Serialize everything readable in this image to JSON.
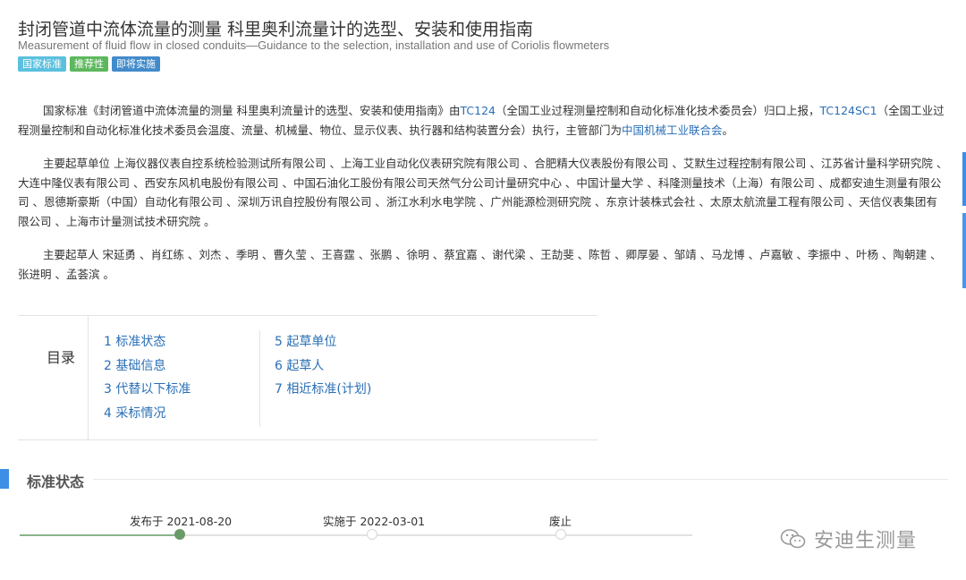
{
  "header": {
    "title": "封闭管道中流体流量的测量 科里奥利流量计的选型、安装和使用指南",
    "subtitle": "Measurement of fluid flow in closed conduits—Guidance to the selection, installation and use of Coriolis flowmeters",
    "badges": [
      {
        "label": "国家标准",
        "color": "#5bc0de"
      },
      {
        "label": "推荐性",
        "color": "#5cb85c"
      },
      {
        "label": "即将实施",
        "color": "#428bca"
      }
    ]
  },
  "intro": {
    "t1": "国家标准《封闭管道中流体流量的测量 科里奥利流量计的选型、安装和使用指南》由",
    "link1": "TC124",
    "t2": "（全国工业过程测量控制和自动化标准化技术委员会）归口上报，",
    "link2": "TC124SC1",
    "t3": "（全国工业过程测量控制和自动化标准化技术委员会温度、流量、机械量、物位、显示仪表、执行器和结构装置分会）执行，主管部门为",
    "link3": "中国机械工业联合会",
    "t4": "。"
  },
  "drafting_units": "主要起草单位 上海仪器仪表自控系统检验测试所有限公司 、上海工业自动化仪表研究院有限公司 、合肥精大仪表股份有限公司 、艾默生过程控制有限公司 、江苏省计量科学研究院 、大连中隆仪表有限公司 、西安东风机电股份有限公司 、中国石油化工股份有限公司天然气分公司计量研究中心 、中国计量大学 、科隆测量技术（上海）有限公司 、成都安迪生测量有限公司 、恩德斯豪斯（中国）自动化有限公司 、深圳万讯自控股份有限公司 、浙江水利水电学院 、广州能源检测研究院 、东京计装株式会社 、太原太航流量工程有限公司 、天信仪表集团有限公司 、上海市计量测试技术研究院 。",
  "drafters": "主要起草人 宋延勇 、肖红练 、刘杰 、季明 、曹久莹 、王喜霆 、张鹏 、徐明 、蔡宜嘉 、谢代梁 、王劼斐 、陈哲 、卿厚晏 、邹靖 、马龙博 、卢嘉敏 、李振中 、叶杨 、陶朝建 、张进明 、孟荟滨 。",
  "toc": {
    "heading": "目录",
    "col1": [
      "1  标准状态",
      "2  基础信息",
      "3  代替以下标准",
      "4  采标情况"
    ],
    "col2": [
      "5  起草单位",
      "6  起草人",
      "7  相近标准(计划)"
    ]
  },
  "status": {
    "heading": "标准状态",
    "timeline": [
      {
        "label": "发布于 2021-08-20",
        "active": true
      },
      {
        "label": "实施于 2022-03-01",
        "active": false
      },
      {
        "label": "废止",
        "active": false
      }
    ]
  },
  "watermark": {
    "text": "安迪生测量",
    "icon": "wechat-icon"
  }
}
